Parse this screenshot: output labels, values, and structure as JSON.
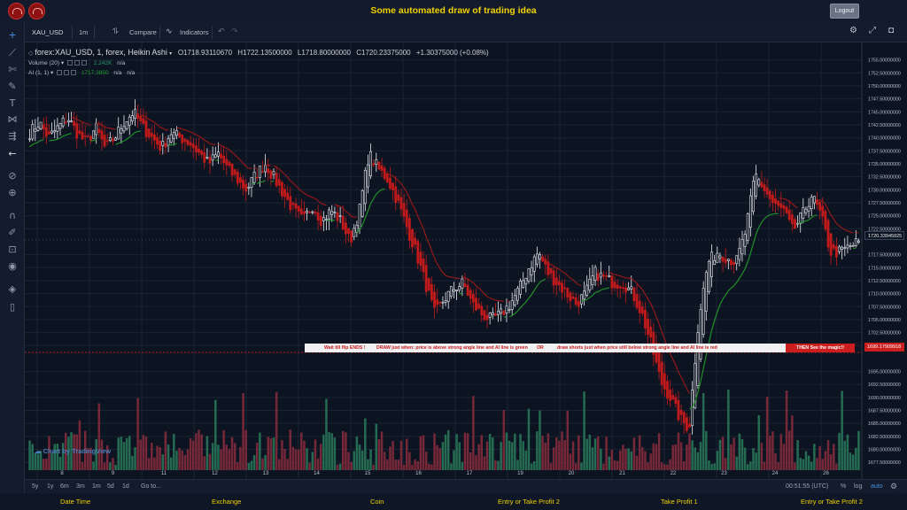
{
  "app": {
    "title": "Some automated draw of trading idea",
    "logout_label": "Logout"
  },
  "header": {
    "symbol": "XAU_USD",
    "interval": "1m",
    "compare_label": "Compare",
    "indicators_label": "Indicators"
  },
  "legend": {
    "symbol_line": "forex:XAU_USD, 1, forex, Heikin Ashi",
    "open": "O1718.93110670",
    "high": "H1722.13500000",
    "low": "L1718.80000000",
    "close": "C1720.23375000",
    "change": "+1.30375000 (+0.08%)",
    "volume_label": "Volume (20)",
    "volume_value": "2.242K",
    "volume_na": "n/a",
    "ai_label": "AI (1, 1)",
    "ai_value": "1717.3850",
    "ai_na1": "n/a",
    "ai_na2": "n/a"
  },
  "banner": {
    "part1": "Wait till flip ENDS !",
    "part2": "DRAW just when:  price is above strong angle line and AI line is green",
    "part3": "OR",
    "part4": "draw shorts just when price still below strong angle line and AI line is red",
    "part5": "THEN See the magic!!"
  },
  "price_axis": {
    "labels": [
      "1755.00000000",
      "1752.50000000",
      "1750.00000000",
      "1747.50000000",
      "1745.00000000",
      "1742.50000000",
      "1740.00000000",
      "1737.50000000",
      "1735.00000000",
      "1732.50000000",
      "1730.00000000",
      "1727.50000000",
      "1725.00000000",
      "1722.50000000",
      "1717.50000000",
      "1715.00000000",
      "1712.50000000",
      "1710.00000000",
      "1707.50000000",
      "1705.00000000",
      "1702.50000000",
      "1700.00000000",
      "1695.00000000",
      "1692.50000000",
      "1690.00000000",
      "1687.50000000",
      "1685.00000000",
      "1682.50000000",
      "1680.00000000",
      "1677.50000000"
    ],
    "current_price": "1720.33945925",
    "line_price": "1699.17909918"
  },
  "time_axis": {
    "labels": [
      "8",
      "9",
      "11",
      "12",
      "13",
      "14",
      "15",
      "16",
      "17",
      "19",
      "20",
      "21",
      "22",
      "23",
      "24",
      "26"
    ]
  },
  "watermark": "Chart by TradingView",
  "bottombar": {
    "ranges": [
      "5y",
      "1y",
      "6m",
      "3m",
      "1m",
      "5d",
      "1d"
    ],
    "goto": "Go to...",
    "clock": "00:51:55 (UTC)",
    "pct": "%",
    "log": "log",
    "auto": "auto"
  },
  "footer": {
    "items": [
      "Date Time",
      "Exchange",
      "Coin",
      "Entry or Take Profit 2",
      "Take Profit 1",
      "Entry or Take Profit 2"
    ]
  },
  "colors": {
    "up": "#ffffff",
    "down": "#c21a1a",
    "ai_green": "#1f9a2a",
    "ai_red": "#a01818",
    "vol_up": "#2a7a5a",
    "vol_down": "#8a2c3c",
    "accent_yellow": "#f2d200"
  },
  "chart_data": {
    "type": "candlestick",
    "style": "Heikin Ashi",
    "symbol": "XAU_USD",
    "ylim": [
      1676,
      1757
    ],
    "close_path": [
      1741,
      1743,
      1740,
      1742,
      1744,
      1741,
      1739,
      1742,
      1738,
      1740,
      1743,
      1745,
      1742,
      1740,
      1738,
      1741,
      1740,
      1739,
      1737,
      1735,
      1737,
      1734,
      1732,
      1730,
      1733,
      1735,
      1732,
      1729,
      1726,
      1724,
      1727,
      1724,
      1726,
      1724,
      1720,
      1726,
      1737,
      1734,
      1732,
      1728,
      1723,
      1718,
      1712,
      1706,
      1709,
      1711,
      1712,
      1708,
      1706,
      1705,
      1706,
      1708,
      1711,
      1715,
      1718,
      1714,
      1712,
      1710,
      1708,
      1710,
      1714,
      1713,
      1712,
      1712,
      1710,
      1706,
      1700,
      1693,
      1690,
      1686,
      1684,
      1705,
      1716,
      1718,
      1717,
      1716,
      1722,
      1733,
      1730,
      1727,
      1726,
      1722,
      1725,
      1729,
      1725,
      1718,
      1718,
      1719,
      1720
    ]
  }
}
